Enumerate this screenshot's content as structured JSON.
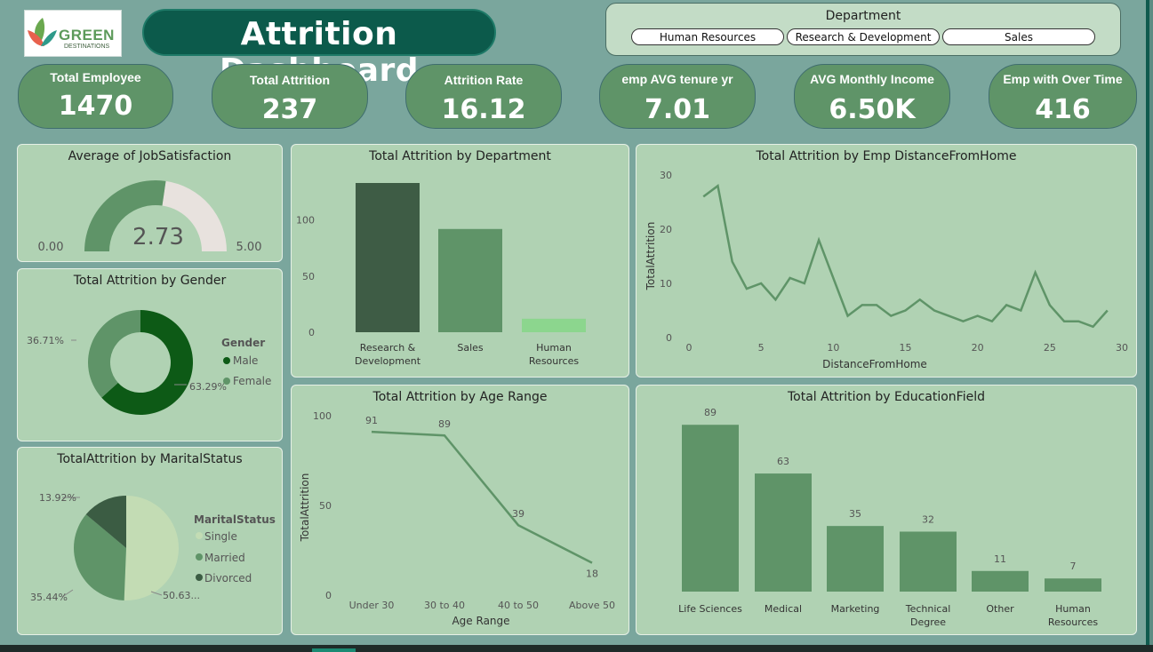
{
  "header": {
    "title": "Attrition Dashboard",
    "logo": {
      "line1": "GREEN",
      "line2": "DESTINATIONS"
    }
  },
  "slicer": {
    "label": "Department",
    "options": [
      "Human Resources",
      "Research & Development",
      "Sales"
    ]
  },
  "kpis": [
    {
      "label": "Total Employee",
      "value": "1470"
    },
    {
      "label": "Total Attrition",
      "value": "237"
    },
    {
      "label": "Attrition Rate",
      "value": "16.12"
    },
    {
      "label": "emp AVG tenure yr",
      "value": "7.01"
    },
    {
      "label": "AVG Monthly Income",
      "value": "6.50K"
    },
    {
      "label": "Emp with Over Time",
      "value": "416"
    }
  ],
  "colors": {
    "dark_green": "#0d5a16",
    "mid_green": "#5f9468",
    "light_green": "#c3dcb4",
    "dark_bar": "#3e5c45",
    "pale_bar": "#8cd68e",
    "gauge_rest": "#e8e2de",
    "divorced": "#3b5c43"
  },
  "chart_data": [
    {
      "id": "job_satisfaction",
      "type": "gauge",
      "title": "Average of JobSatisfaction",
      "value": 2.73,
      "value_label": "2.73",
      "min": 0,
      "max": 5,
      "min_label": "0.00",
      "max_label": "5.00"
    },
    {
      "id": "gender",
      "type": "pie",
      "variant": "donut",
      "title": "Total Attrition by Gender",
      "legend_title": "Gender",
      "categories": [
        "Male",
        "Female"
      ],
      "values": [
        63.29,
        36.71
      ],
      "labels": [
        "63.29%",
        "36.71%"
      ]
    },
    {
      "id": "marital",
      "type": "pie",
      "title": "TotalAttrition by MaritalStatus",
      "legend_title": "MaritalStatus",
      "categories": [
        "Single",
        "Married",
        "Divorced"
      ],
      "values": [
        50.63,
        35.44,
        13.92
      ],
      "labels": [
        "50.63...",
        "35.44%",
        "13.92%"
      ]
    },
    {
      "id": "department",
      "type": "bar",
      "title": "Total Attrition by Department",
      "categories": [
        "Research & Development",
        "Sales",
        "Human Resources"
      ],
      "category_lines": [
        [
          "Research &",
          "Development"
        ],
        [
          "Sales"
        ],
        [
          "Human",
          "Resources"
        ]
      ],
      "values": [
        133,
        92,
        12
      ],
      "ylim": [
        0,
        133
      ],
      "yticks": [
        0,
        50,
        100
      ]
    },
    {
      "id": "distance",
      "type": "line",
      "title": "Total Attrition by Emp DistanceFromHome",
      "xlabel": "DistanceFromHome",
      "ylabel": "TotalAttrition",
      "x": [
        1,
        2,
        3,
        4,
        5,
        6,
        7,
        8,
        9,
        10,
        11,
        12,
        13,
        14,
        15,
        16,
        17,
        18,
        19,
        20,
        21,
        22,
        23,
        24,
        25,
        26,
        27,
        28,
        29
      ],
      "y": [
        26,
        28,
        14,
        9,
        10,
        7,
        11,
        10,
        18,
        11,
        4,
        6,
        6,
        4,
        5,
        7,
        5,
        4,
        3,
        4,
        3,
        6,
        5,
        12,
        6,
        3,
        3,
        2,
        5
      ],
      "xlim": [
        0,
        30
      ],
      "ylim": [
        0,
        30
      ],
      "xticks": [
        0,
        5,
        10,
        15,
        20,
        25,
        30
      ],
      "yticks": [
        0,
        10,
        20,
        30
      ]
    },
    {
      "id": "age_range",
      "type": "line",
      "title": "Total Attrition by Age Range",
      "xlabel": "Age Range",
      "ylabel": "TotalAttrition",
      "categories": [
        "Under 30",
        "30 to 40",
        "40 to 50",
        "Above 50"
      ],
      "values": [
        91,
        89,
        39,
        18
      ],
      "ylim": [
        0,
        100
      ],
      "yticks": [
        0,
        50,
        100
      ]
    },
    {
      "id": "education",
      "type": "bar",
      "title": "Total Attrition by EducationField",
      "categories": [
        "Life Sciences",
        "Medical",
        "Marketing",
        "Technical Degree",
        "Other",
        "Human Resources"
      ],
      "category_lines": [
        [
          "Life Sciences"
        ],
        [
          "Medical"
        ],
        [
          "Marketing"
        ],
        [
          "Technical",
          "Degree"
        ],
        [
          "Other"
        ],
        [
          "Human",
          "Resources"
        ]
      ],
      "values": [
        89,
        63,
        35,
        32,
        11,
        7
      ],
      "ylim": [
        0,
        100
      ]
    }
  ]
}
